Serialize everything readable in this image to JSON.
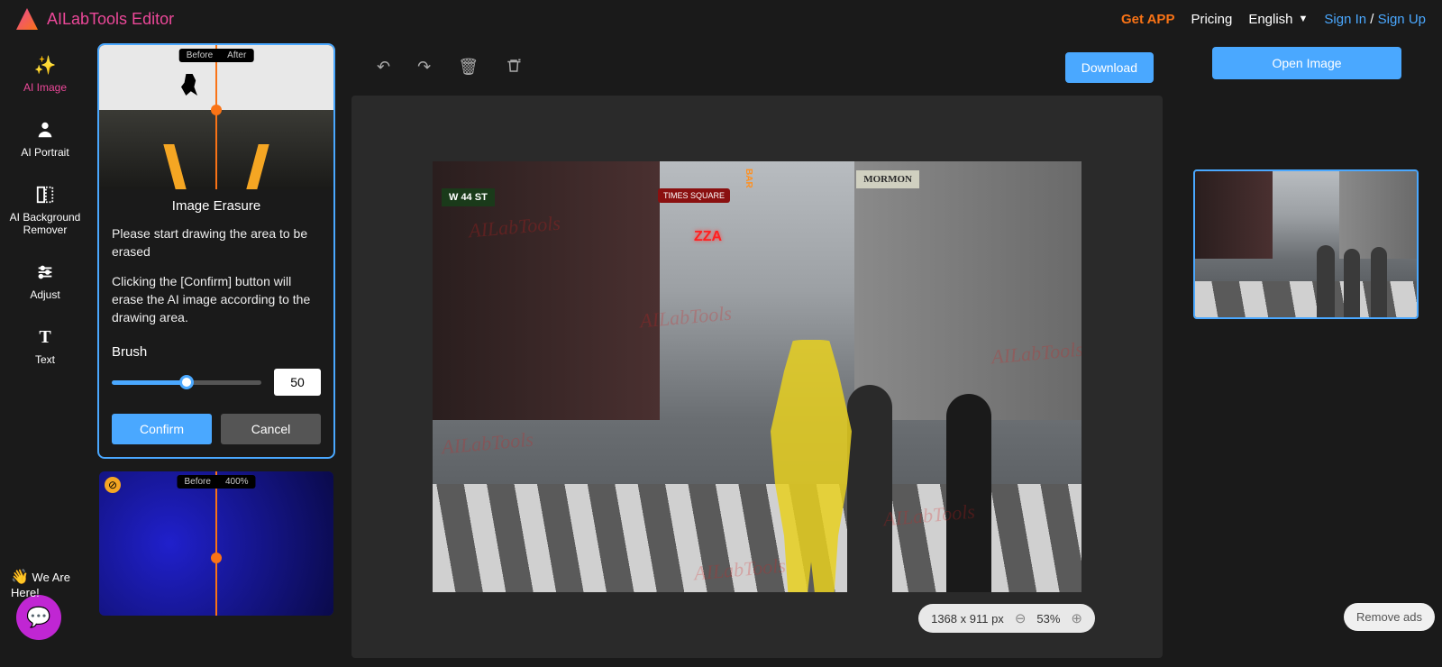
{
  "header": {
    "brand": "AILabTools Editor",
    "get_app": "Get APP",
    "pricing": "Pricing",
    "language": "English",
    "sign_in": "Sign In",
    "sign_up": "Sign Up",
    "separator": "/"
  },
  "sidebar": {
    "items": [
      {
        "label": "AI Image",
        "active": true
      },
      {
        "label": "AI Portrait",
        "active": false
      },
      {
        "label": "AI Background Remover",
        "active": false
      },
      {
        "label": "Adjust",
        "active": false
      },
      {
        "label": "Text",
        "active": false
      }
    ]
  },
  "tool": {
    "preview_before": "Before",
    "preview_after": "After",
    "title": "Image Erasure",
    "desc_line1": "Please start drawing the area to be erased",
    "desc_line2": "Clicking the [Confirm] button will erase the AI image according to the drawing area.",
    "brush_label": "Brush",
    "brush_value": "50",
    "confirm": "Confirm",
    "cancel": "Cancel",
    "secondary_before": "Before",
    "secondary_zoom": "400%"
  },
  "canvas": {
    "download": "Download",
    "dimensions": "1368 x 911 px",
    "zoom": "53%",
    "signs": {
      "w44": "W 44 ST",
      "times_square": "TIMES SQUARE",
      "zza": "ZZA",
      "bar": "BAR",
      "mormon": "MORMON"
    },
    "watermark": "AILabTools"
  },
  "right": {
    "open_image": "Open Image"
  },
  "chat": {
    "text": "We Are Here!"
  },
  "ads": {
    "remove": "Remove ads"
  }
}
